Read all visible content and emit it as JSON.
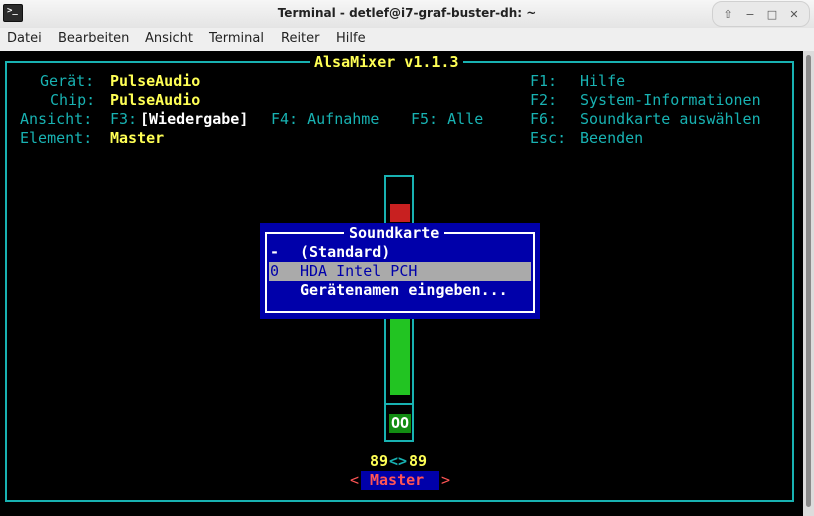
{
  "window": {
    "title": "Terminal - detlef@i7-graf-buster-dh: ~",
    "app_icon_glyph": ">_"
  },
  "menubar": {
    "items": [
      "Datei",
      "Bearbeiten",
      "Ansicht",
      "Terminal",
      "Reiter",
      "Hilfe"
    ]
  },
  "alsamixer": {
    "title": "AlsaMixer v1.1.3",
    "device_label": "Gerät:",
    "device_value": "PulseAudio",
    "chip_label": "Chip:",
    "chip_value": "PulseAudio",
    "view_label": "Ansicht:",
    "view_f3": "F3:",
    "view_f3_value": "[Wiedergabe]",
    "view_f4": "F4: Aufnahme",
    "view_f5": "F5: Alle",
    "element_label": "Element:",
    "element_value": "Master",
    "help": [
      {
        "key": "F1:",
        "text": "Hilfe"
      },
      {
        "key": "F2:",
        "text": "System-Informationen"
      },
      {
        "key": "F6:",
        "text": "Soundkarte auswählen"
      },
      {
        "key": "Esc:",
        "text": "Beenden"
      }
    ],
    "mute_indicator": "OO",
    "volume_left": "89",
    "volume_sep": "<>",
    "volume_right": "89",
    "control_name": "Master",
    "control_left_arrow": "<",
    "control_right_arrow": ">"
  },
  "dialog": {
    "title": "Soundkarte",
    "options": [
      {
        "key": "-",
        "label": "(Standard)",
        "selected": false
      },
      {
        "key": "0",
        "label": "HDA Intel PCH",
        "selected": true
      },
      {
        "key": "",
        "label": "Gerätenamen eingeben...",
        "selected": false
      }
    ]
  },
  "colors": {
    "teal": "#18b2b2",
    "yellow": "#ffff55",
    "dialog_bg": "#0000aa",
    "selection": "#aaaaaa",
    "volume_green": "#22c422",
    "volume_red": "#c82020"
  }
}
